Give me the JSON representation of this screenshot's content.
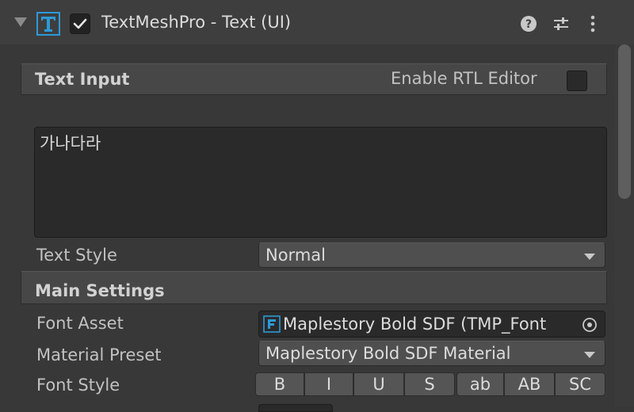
{
  "header": {
    "title": "TextMeshPro - Text (UI)",
    "enabled": true,
    "icons": [
      "foldout-arrow-icon",
      "textmeshpro-t-icon",
      "checkmark-icon",
      "help-icon",
      "preset-icon",
      "more-menu-icon"
    ]
  },
  "text_input": {
    "section_title": "Text Input",
    "rtl_label": "Enable RTL Editor",
    "rtl_enabled": false,
    "text_value": "가나다라"
  },
  "text_style": {
    "label": "Text Style",
    "value": "Normal"
  },
  "main_settings": {
    "section_title": "Main Settings",
    "font_asset": {
      "label": "Font Asset",
      "value": "Maplestory Bold SDF (TMP_Font"
    },
    "material_preset": {
      "label": "Material Preset",
      "value": "Maplestory Bold SDF Material"
    },
    "font_style": {
      "label": "Font Style",
      "buttons": [
        "B",
        "I",
        "U",
        "S",
        "ab",
        "AB",
        "SC"
      ]
    }
  },
  "colors": {
    "background": "#383838",
    "accent_blue": "#2d9ad8"
  }
}
